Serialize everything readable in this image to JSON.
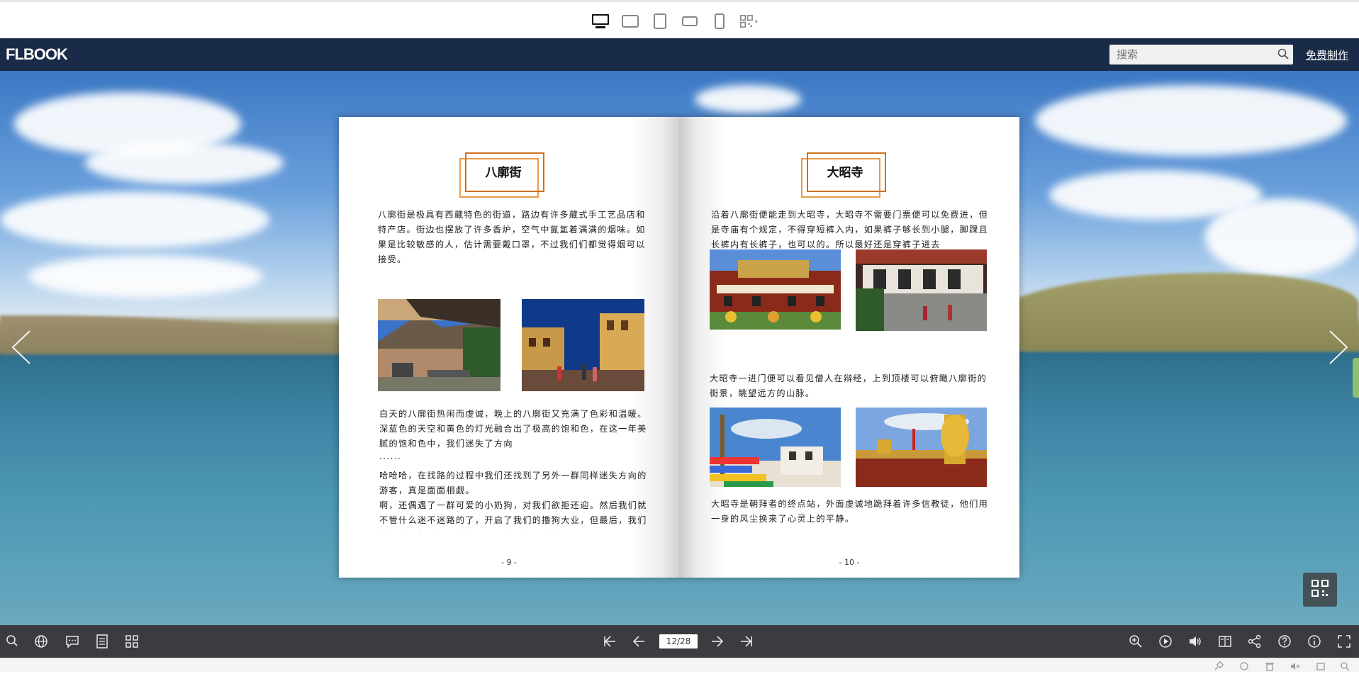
{
  "devices": {
    "items": [
      "desktop-icon",
      "tablet-landscape-icon",
      "tablet-portrait-icon",
      "phone-landscape-icon",
      "phone-portrait-icon",
      "qrcode-icon"
    ]
  },
  "header": {
    "logo": "FLBOOK",
    "search_placeholder": "搜索",
    "free_make": "免费制作"
  },
  "book": {
    "left": {
      "title": "八廓街",
      "para1": "八廓街是极具有西藏特色的街道，路边有许多藏式手工艺品店和特产店。街边也摆放了许多香炉，空气中氤氲着满满的烟味。如果是比较敏感的人，估计需要戴口罩，不过我们们都觉得烟可以接受。",
      "para2": "白天的八廓街热闹而虔诚，晚上的八廓街又充满了色彩和温暖。深蓝色的天空和黄色的灯光融合出了极高的饱和色，在这一年美腻的饱和色中，我们迷失了方向",
      "dots": "······",
      "para3": "哈哈哈，在找路的过程中我们还找到了另外一群同样迷失方向的游客，真是面面相觑。",
      "para4": "啊，还偶遇了一群可爱的小奶狗，对我们欲拒还迎。然后我们就不管什么迷不迷路的了，开启了我们的撸狗大业，但最后，我们竟然连一根手都没碰着！！！狗子也是太独",
      "page_num": "- 9 -"
    },
    "right": {
      "title": "大昭寺",
      "para1": "沿着八廓街便能走到大昭寺，大昭寺不需要门票便可以免费进，但是寺庙有个规定，不得穿短裤入内，如果裤子够长到小腿，脚踝且长裤内有长裤子，也可以的。所以最好还是穿裤子进去",
      "para2": "大昭寺一进门便可以看见僧人在辩经，上到顶楼可以俯瞰八廓街的街景，眺望远方的山脉。",
      "para3": "大昭寺是朝拜者的终点站，外面虔诚地跪拜着许多信教徒，他们用一身的风尘换来了心灵上的平静。",
      "page_num": "- 10 -"
    }
  },
  "toolbar": {
    "page_indicator": "12/28",
    "left_icons": [
      "search-icon",
      "globe-icon",
      "comment-icon",
      "notes-icon",
      "thumbnails-icon"
    ],
    "nav_icons": [
      "first-page-icon",
      "prev-page-icon",
      "next-page-icon",
      "last-page-icon"
    ],
    "right_icons": [
      "zoom-in-icon",
      "autoplay-icon",
      "sound-icon",
      "bookmark-icon",
      "share-icon",
      "help-icon",
      "info-icon",
      "fullscreen-icon"
    ]
  }
}
